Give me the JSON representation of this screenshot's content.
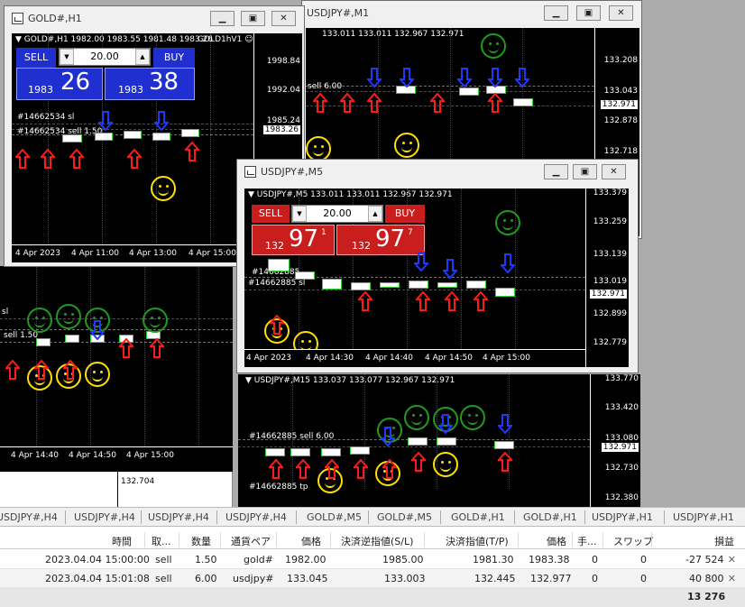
{
  "windows": {
    "gold": {
      "title": "GOLD#,H1",
      "header": "GOLD#,H1  1982.00 1983.55 1981.48 1983.26",
      "indicator": "GOLD1hV1",
      "sell_label": "SELL",
      "buy_label": "BUY",
      "lot": "20.00",
      "sell_small": "1983",
      "sell_big": "26",
      "buy_small": "1983",
      "buy_big": "38",
      "prices": [
        "1998.84",
        "1992.04",
        "1985.24",
        "1983.26"
      ],
      "current_price": "1983.26",
      "times": [
        "4 Apr 2023",
        "4 Apr 11:00",
        "4 Apr 13:00",
        "4 Apr 15:00"
      ],
      "order_label": "#14662534 sl",
      "order_label2": "#14662534 sell 1.50"
    },
    "usdjpy_m1": {
      "title": "USDJPY#,M1",
      "header": "133.011 133.011 132.967 132.971",
      "prices": [
        "133.208",
        "133.043",
        "132.971",
        "132.878",
        "132.718"
      ],
      "current_price": "132.971",
      "sell_label": "sell 6.00"
    },
    "usdjpy_m5": {
      "title": "USDJPY#,M5",
      "header": "USDJPY#,M5  133.011 133.011 132.967 132.971",
      "sell_label": "SELL",
      "buy_label": "BUY",
      "lot": "20.00",
      "sell_small": "132",
      "sell_big": "97",
      "sell_sup": "1",
      "buy_small": "132",
      "buy_big": "97",
      "buy_sup": "7",
      "prices": [
        "133.379",
        "133.259",
        "133.139",
        "133.019",
        "132.971",
        "132.899",
        "132.779"
      ],
      "current_price": "132.971",
      "times": [
        "4 Apr 2023",
        "4 Apr 14:30",
        "4 Apr 14:40",
        "4 Apr 14:50",
        "4 Apr 15:00"
      ],
      "order_label": "#14662885 sl",
      "order_label2": "#14662885"
    },
    "left_lower": {
      "sell_label": "sell 1.50",
      "sl_label": "sl",
      "times": [
        "4 Apr 14:40",
        "4 Apr 14:50",
        "4 Apr 15:00"
      ],
      "price": "132.704"
    },
    "usdjpy_m15": {
      "header": "USDJPY#,M15  133.037 133.077 132.967 132.971",
      "prices": [
        "133.770",
        "133.420",
        "133.080",
        "132.971",
        "132.730",
        "132.380"
      ],
      "current_price": "132.971",
      "order_label": "#14662885 sell 6.00",
      "order_label2": "#14662885 tp"
    }
  },
  "tabs": [
    "USDJPY#,H4",
    "USDJPY#,H4",
    "USDJPY#,H4",
    "USDJPY#,H4",
    "GOLD#,M5",
    "GOLD#,M5",
    "GOLD#,H1",
    "GOLD#,H1",
    "USDJPY#,H1",
    "USDJPY#,H1"
  ],
  "table": {
    "headers": [
      "時間",
      "取...",
      "数量",
      "通貨ペア",
      "価格",
      "決済逆指値(S/L)",
      "決済指値(T/P)",
      "価格",
      "手...",
      "スワップ",
      "損益"
    ],
    "rows": [
      [
        "2023.04.04 15:00:00",
        "sell",
        "1.50",
        "gold#",
        "1982.00",
        "1985.00",
        "1981.30",
        "1983.38",
        "0",
        "0",
        "-27 524"
      ],
      [
        "2023.04.04 15:01:08",
        "sell",
        "6.00",
        "usdjpy#",
        "133.045",
        "133.003",
        "132.445",
        "132.977",
        "0",
        "0",
        "40 800"
      ]
    ],
    "total": "13 276"
  },
  "colors": {
    "sell_blue": "#1f2fd0",
    "sell_red": "#c81e1e",
    "arrow_red": "#ff1a1a",
    "arrow_blue": "#1f38ff",
    "smiley_green": "#1e9c1e",
    "smiley_yellow": "#ffe000"
  }
}
